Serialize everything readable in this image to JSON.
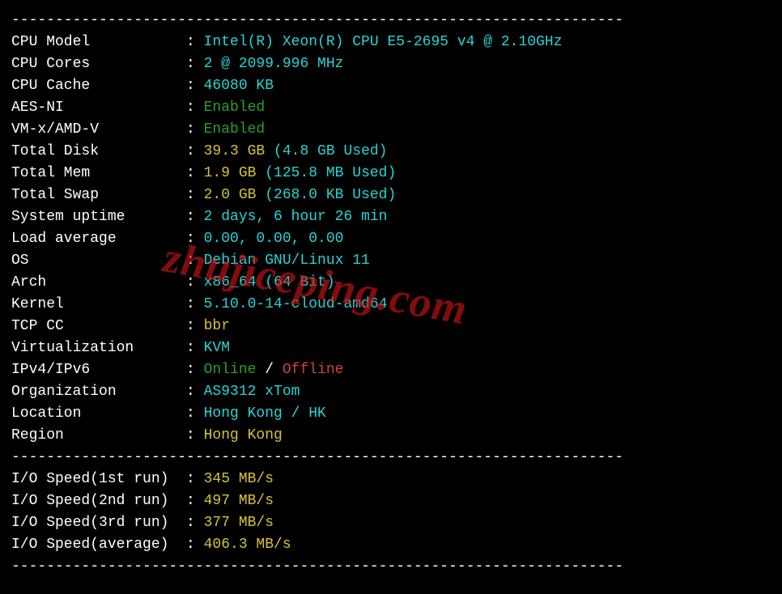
{
  "divider": "----------------------------------------------------------------------",
  "rows": [
    {
      "label": "CPU Model",
      "parts": [
        {
          "text": "Intel(R) Xeon(R) CPU E5-2695 v4 @ 2.10GHz",
          "cls": "cyan"
        }
      ]
    },
    {
      "label": "CPU Cores",
      "parts": [
        {
          "text": "2 @ 2099.996 MHz",
          "cls": "cyan"
        }
      ]
    },
    {
      "label": "CPU Cache",
      "parts": [
        {
          "text": "46080 KB",
          "cls": "cyan"
        }
      ]
    },
    {
      "label": "AES-NI",
      "parts": [
        {
          "text": "Enabled",
          "cls": "green"
        }
      ]
    },
    {
      "label": "VM-x/AMD-V",
      "parts": [
        {
          "text": "Enabled",
          "cls": "green"
        }
      ]
    },
    {
      "label": "Total Disk",
      "parts": [
        {
          "text": "39.3 GB ",
          "cls": "yellow"
        },
        {
          "text": "(4.8 GB Used)",
          "cls": "cyan"
        }
      ]
    },
    {
      "label": "Total Mem",
      "parts": [
        {
          "text": "1.9 GB ",
          "cls": "yellow"
        },
        {
          "text": "(125.8 MB Used)",
          "cls": "cyan"
        }
      ]
    },
    {
      "label": "Total Swap",
      "parts": [
        {
          "text": "2.0 GB ",
          "cls": "yellow"
        },
        {
          "text": "(268.0 KB Used)",
          "cls": "cyan"
        }
      ]
    },
    {
      "label": "System uptime",
      "parts": [
        {
          "text": "2 days, 6 hour 26 min",
          "cls": "cyan"
        }
      ]
    },
    {
      "label": "Load average",
      "parts": [
        {
          "text": "0.00, 0.00, 0.00",
          "cls": "cyan"
        }
      ]
    },
    {
      "label": "OS",
      "parts": [
        {
          "text": "Debian GNU/Linux 11",
          "cls": "cyan"
        }
      ]
    },
    {
      "label": "Arch",
      "parts": [
        {
          "text": "x86_64 (64 Bit)",
          "cls": "cyan"
        }
      ]
    },
    {
      "label": "Kernel",
      "parts": [
        {
          "text": "5.10.0-14-cloud-amd64",
          "cls": "cyan"
        }
      ]
    },
    {
      "label": "TCP CC",
      "parts": [
        {
          "text": "bbr",
          "cls": "yellow"
        }
      ]
    },
    {
      "label": "Virtualization",
      "parts": [
        {
          "text": "KVM",
          "cls": "cyan"
        }
      ]
    },
    {
      "label": "IPv4/IPv6",
      "parts": [
        {
          "text": "Online",
          "cls": "green"
        },
        {
          "text": " / ",
          "cls": "white"
        },
        {
          "text": "Offline",
          "cls": "red"
        }
      ]
    },
    {
      "label": "Organization",
      "parts": [
        {
          "text": "AS9312 xTom",
          "cls": "cyan"
        }
      ]
    },
    {
      "label": "Location",
      "parts": [
        {
          "text": "Hong Kong / HK",
          "cls": "cyan"
        }
      ]
    },
    {
      "label": "Region",
      "parts": [
        {
          "text": "Hong Kong",
          "cls": "yellow"
        }
      ]
    }
  ],
  "io_rows": [
    {
      "label": "I/O Speed(1st run)",
      "parts": [
        {
          "text": "345 MB/s",
          "cls": "yellow"
        }
      ]
    },
    {
      "label": "I/O Speed(2nd run)",
      "parts": [
        {
          "text": "497 MB/s",
          "cls": "yellow"
        }
      ]
    },
    {
      "label": "I/O Speed(3rd run)",
      "parts": [
        {
          "text": "377 MB/s",
          "cls": "yellow"
        }
      ]
    },
    {
      "label": "I/O Speed(average)",
      "parts": [
        {
          "text": "406.3 MB/s",
          "cls": "yellow"
        }
      ]
    }
  ],
  "watermark": "zhujiceping.com"
}
